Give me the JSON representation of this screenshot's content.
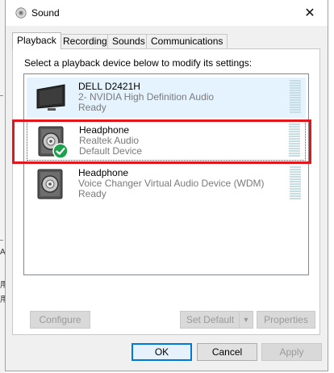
{
  "window": {
    "title": "Sound"
  },
  "tabs": [
    {
      "label": "Playback",
      "active": true
    },
    {
      "label": "Recording",
      "active": false
    },
    {
      "label": "Sounds",
      "active": false
    },
    {
      "label": "Communications",
      "active": false
    }
  ],
  "instruction": "Select a playback device below to modify its settings:",
  "devices": [
    {
      "name": "DELL D2421H",
      "line1": "2- NVIDIA High Definition Audio",
      "line2": "Ready",
      "icon": "monitor-icon",
      "selected": true,
      "default": false
    },
    {
      "name": "Headphone",
      "line1": "Realtek Audio",
      "line2": "Default Device",
      "icon": "headphone-speaker-icon",
      "selected": false,
      "default": true
    },
    {
      "name": "Headphone",
      "line1": "Voice Changer Virtual Audio Device (WDM)",
      "line2": "Ready",
      "icon": "headphone-speaker-icon",
      "selected": false,
      "default": false
    }
  ],
  "buttons": {
    "configure": "Configure",
    "set_default": "Set Default",
    "properties": "Properties",
    "ok": "OK",
    "cancel": "Cancel",
    "apply": "Apply"
  },
  "colors": {
    "selection": "#e5f3ff",
    "highlight_border": "#e0181e",
    "default_check": "#1aa34a",
    "default_button_border": "#0078d7"
  },
  "backdrop": {
    "fragments": [
      "A",
      "用",
      "用"
    ]
  }
}
